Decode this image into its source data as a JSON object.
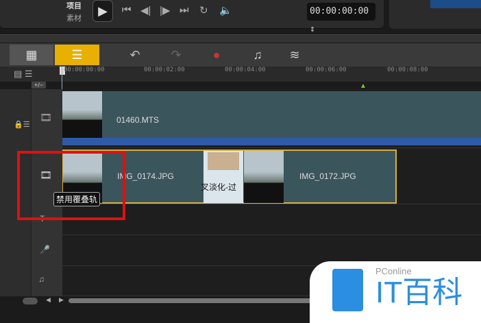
{
  "player": {
    "project_label": "项目",
    "clip_label": "素材",
    "timecode": "00:00:00:00"
  },
  "toolbar": {
    "icons": [
      "storyboard-view-icon",
      "timeline-view-icon",
      "undo-icon",
      "redo-icon",
      "record-capture-icon",
      "auto-music-icon",
      "smart-proxy-icon"
    ],
    "add_remove_label": "+/−"
  },
  "ruler": {
    "ticks": [
      "00:00:00:00",
      "00:00:02:00",
      "00:00:04:00",
      "00:00:06:00",
      "00:00:08:00"
    ]
  },
  "tracks": {
    "video": {
      "clip": "01460.MTS"
    },
    "overlay": {
      "clip1": "IMG_0174.JPG",
      "transition": "叉淡化-过",
      "clip2": "IMG_0172.JPG",
      "tooltip": "禁用覆叠轨"
    }
  },
  "colors": {
    "accent": "#f0b400",
    "highlight": "#e01010",
    "clip": "#3b555c"
  },
  "watermark": {
    "brand": "PConline",
    "title": "IT百科"
  }
}
